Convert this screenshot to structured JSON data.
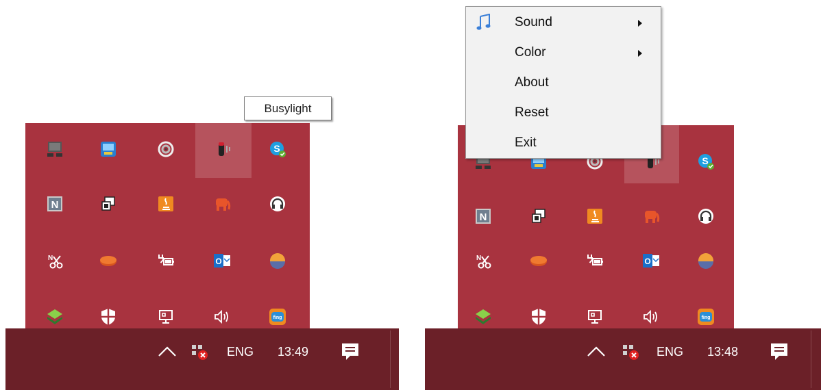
{
  "left": {
    "tooltip": "Busylight",
    "taskbar": {
      "lang": "ENG",
      "time": "13:49"
    }
  },
  "right": {
    "menu": {
      "items": [
        {
          "label": "Sound",
          "submenu": true
        },
        {
          "label": "Color",
          "submenu": true
        },
        {
          "label": "About",
          "submenu": false
        },
        {
          "label": "Reset",
          "submenu": false
        },
        {
          "label": "Exit",
          "submenu": false
        }
      ]
    },
    "taskbar": {
      "lang": "ENG",
      "time": "13:48"
    }
  },
  "tray_icons": [
    [
      "monitor-icon",
      "network-app-icon",
      "spiral-icon",
      "busylight-icon",
      "skype-icon"
    ],
    [
      "n-app-icon",
      "copy-windows-icon",
      "java-icon",
      "elephant-icon",
      "headphones-icon"
    ],
    [
      "onenote-clipper-icon",
      "orange-disc-icon",
      "battery-plug-icon",
      "outlook-icon",
      "weather-icon"
    ],
    [
      "shield-green-icon",
      "security-shield-icon",
      "display-network-icon",
      "speaker-icon",
      "app-orange-icon"
    ]
  ],
  "colors": {
    "panel": "#a8333f",
    "taskbar": "#6b2028",
    "menu_bg": "#f2f2f2"
  }
}
